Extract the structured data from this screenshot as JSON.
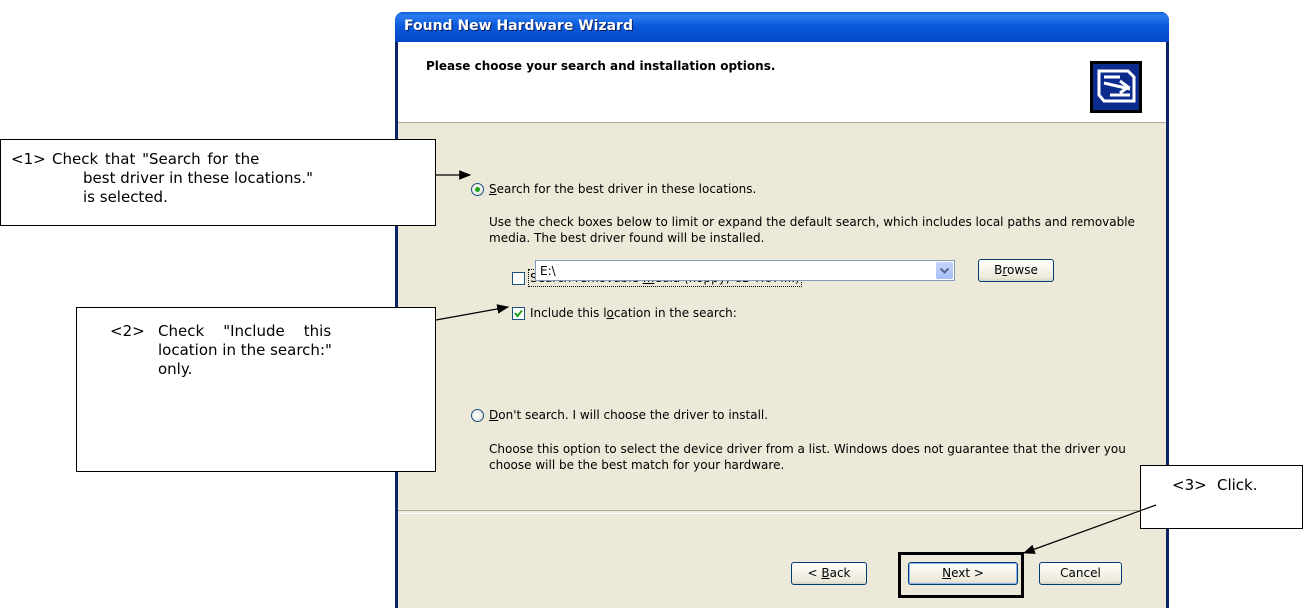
{
  "window": {
    "title": "Found New Hardware Wizard"
  },
  "header": {
    "heading": "Please choose your search and installation options.",
    "icon": "hardware-install-icon"
  },
  "options": {
    "search_radio": {
      "label_prefix": "",
      "label_key": "S",
      "label_rest": "earch for the best driver in these locations.",
      "selected": true
    },
    "search_description": "Use the check boxes below to limit or expand the default search, which includes local paths and removable media. The best driver found will be installed.",
    "removable_media": {
      "label_pre": "Search removable ",
      "label_key": "m",
      "label_rest": "edia (floppy, CD-ROM...)",
      "checked": false
    },
    "include_location": {
      "label_pre": "Include this l",
      "label_key": "o",
      "label_rest": "cation in the search:",
      "checked": true
    },
    "location_value": "E:\\",
    "browse": {
      "pre": "B",
      "key": "r",
      "rest": "owse"
    },
    "dont_search_radio": {
      "label_key": "D",
      "label_rest": "on't search. I will choose the driver to install.",
      "selected": false
    },
    "dont_search_description": "Choose this option to select the device driver from a list.  Windows does not guarantee that the driver you choose will be the best match for your hardware."
  },
  "buttons": {
    "back": {
      "pre": "< ",
      "key": "B",
      "rest": "ack"
    },
    "next": {
      "key": "N",
      "rest": "ext >"
    },
    "cancel": "Cancel"
  },
  "callouts": {
    "c1": {
      "num": "<1>",
      "lines": [
        "Check that \"Search for the",
        "best driver in these locations.\"",
        "is selected."
      ]
    },
    "c2": {
      "num": "<2>",
      "lines": [
        "Check    \"Include    this",
        "location in the search:\"",
        "only."
      ]
    },
    "c3": {
      "num": "<3>",
      "text": "Click."
    }
  },
  "colors": {
    "titlebar": "#0b5bdc",
    "dialog": "#ece9d8",
    "radio_dot": "#21a121"
  }
}
